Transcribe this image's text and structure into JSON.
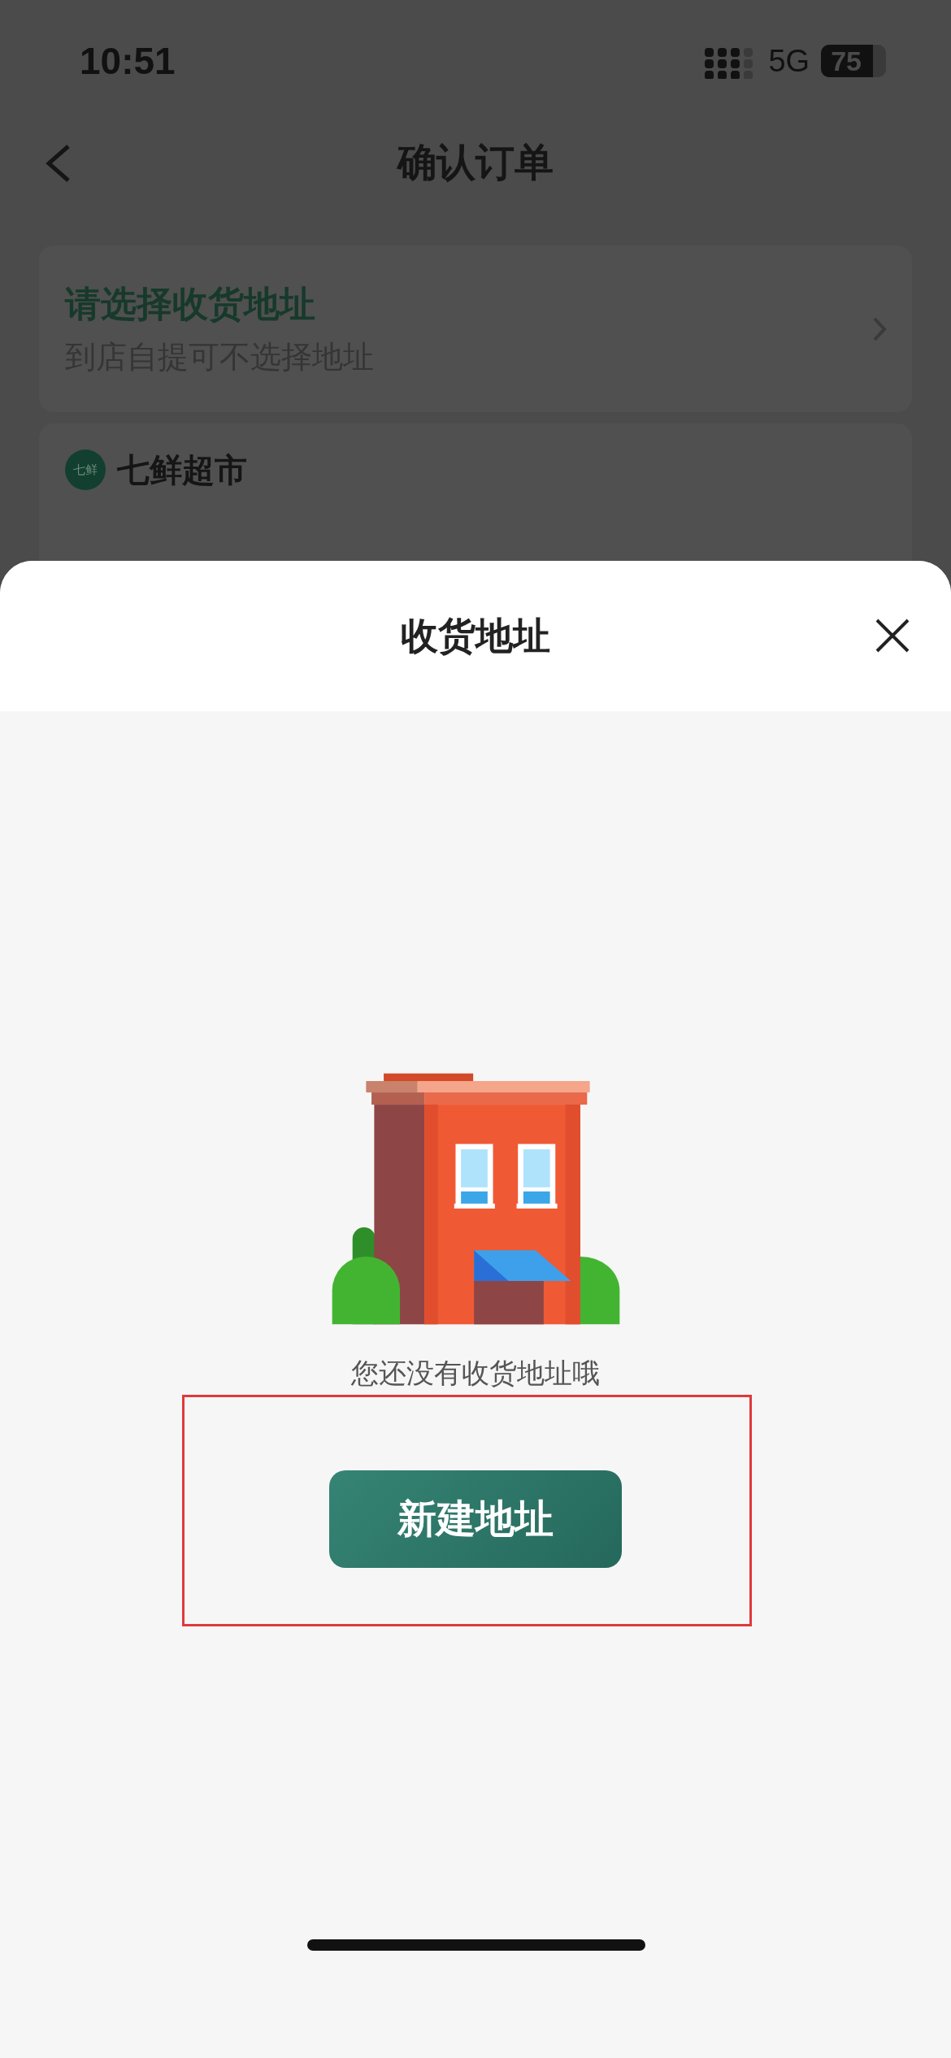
{
  "status_bar": {
    "time": "10:51",
    "network": "5G",
    "battery": "75"
  },
  "nav": {
    "title": "确认订单"
  },
  "address_card": {
    "title": "请选择收货地址",
    "subtitle": "到店自提可不选择地址"
  },
  "store": {
    "logo": "七鲜",
    "name": "七鲜超市"
  },
  "sheet": {
    "title": "收货地址",
    "empty_message": "您还没有收货地址哦",
    "button": "新建地址"
  }
}
